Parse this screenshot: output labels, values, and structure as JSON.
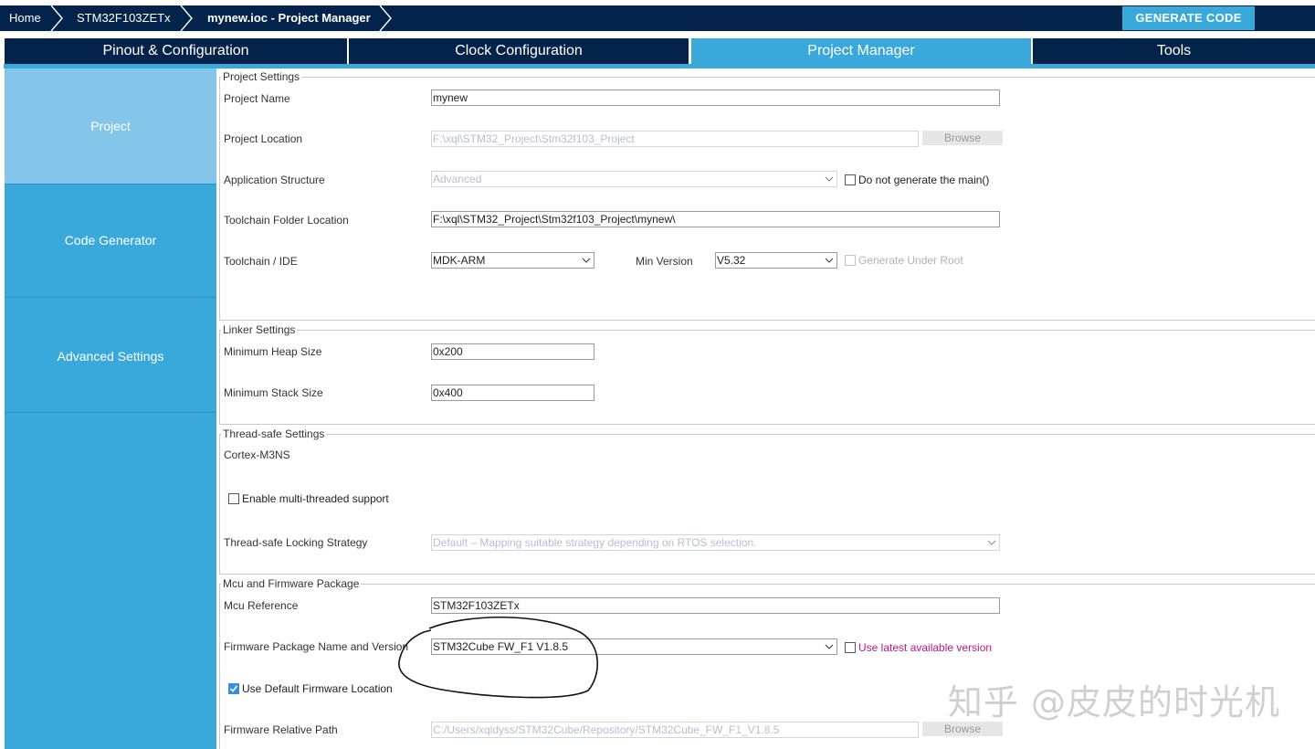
{
  "breadcrumb": {
    "home": "Home",
    "mcu": "STM32F103ZETx",
    "project": "mynew.ioc - Project Manager"
  },
  "generate_label": "GENERATE CODE",
  "tabs": [
    {
      "label": "Pinout & Configuration"
    },
    {
      "label": "Clock Configuration"
    },
    {
      "label": "Project Manager"
    },
    {
      "label": "Tools"
    }
  ],
  "sidebar": {
    "items": [
      {
        "label": "Project"
      },
      {
        "label": "Code Generator"
      },
      {
        "label": "Advanced Settings"
      }
    ]
  },
  "project_settings": {
    "legend": "Project Settings",
    "name_label": "Project Name",
    "name_value": "mynew",
    "location_label": "Project Location",
    "location_value": "F:\\xql\\STM32_Project\\Stm32f103_Project",
    "browse": "Browse",
    "app_structure_label": "Application Structure",
    "app_structure_value": "Advanced",
    "no_main_label": "Do not generate the main()",
    "toolchain_folder_label": "Toolchain Folder Location",
    "toolchain_folder_value": "F:\\xql\\STM32_Project\\Stm32f103_Project\\mynew\\",
    "toolchain_ide_label": "Toolchain / IDE",
    "toolchain_ide_value": "MDK-ARM",
    "min_version_label": "Min Version",
    "min_version_value": "V5.32",
    "gen_under_root_label": "Generate Under Root"
  },
  "linker_settings": {
    "legend": "Linker Settings",
    "heap_label": "Minimum Heap Size",
    "heap_value": "0x200",
    "stack_label": "Minimum Stack Size",
    "stack_value": "0x400"
  },
  "thread_safe": {
    "legend": "Thread-safe Settings",
    "core": "Cortex-M3NS",
    "multi_thread_label": "Enable multi-threaded support",
    "locking_label": "Thread-safe Locking Strategy",
    "locking_value": "Default  –  Mapping suitable strategy depending on RTOS selection."
  },
  "firmware": {
    "legend": "Mcu and Firmware Package",
    "mcu_ref_label": "Mcu Reference",
    "mcu_ref_value": "STM32F103ZETx",
    "pkg_label": "Firmware Package Name and Version",
    "pkg_value": "STM32Cube FW_F1 V1.8.5",
    "use_latest_label": "Use latest available version",
    "default_loc_label": "Use Default Firmware Location",
    "rel_path_label": "Firmware Relative Path",
    "rel_path_value": "C:/Users/xqldyss/STM32Cube/Repository/STM32Cube_FW_F1_V1.8.5",
    "browse": "Browse"
  },
  "watermark": "知乎 @皮皮的时光机",
  "icons": [
    "chevron-right-icon",
    "dropdown-arrow-icon",
    "checkbox-icon",
    "check-icon"
  ],
  "colors": {
    "navy": "#03234b",
    "accent": "#39a9dc",
    "sidebar_active": "#84c6ea",
    "link_magenta": "#c0168a"
  }
}
